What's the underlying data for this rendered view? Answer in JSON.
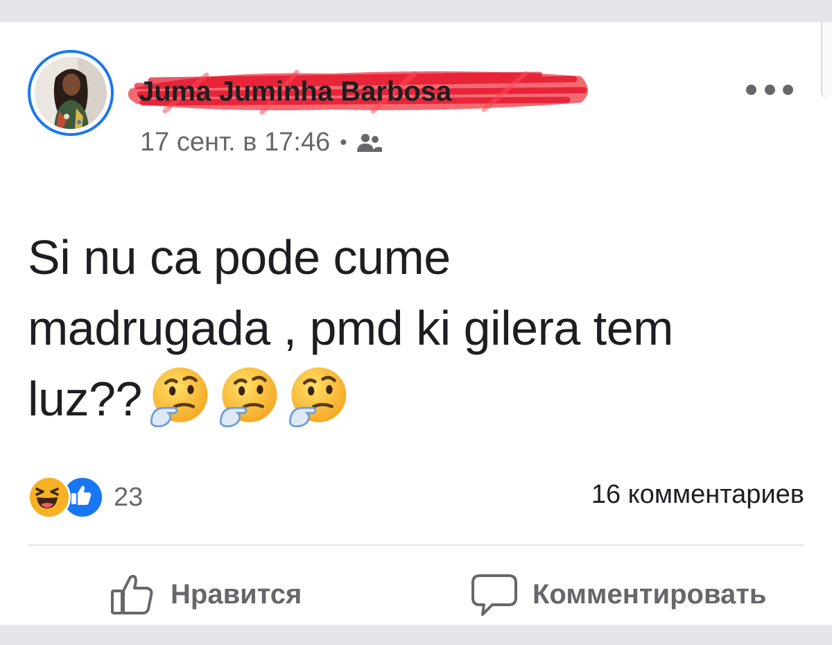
{
  "post": {
    "author_name": "Juma Juminha Barbosa",
    "timestamp": "17 сент. в 17:46",
    "separator": "•",
    "privacy_icon": "friends-icon",
    "text_lines": [
      "Si nu ca pode cume",
      "madrugada  , pmd ki gilera tem",
      "luz??"
    ],
    "emojis": [
      "thinking-face",
      "thinking-face",
      "thinking-face"
    ]
  },
  "reactions": {
    "types": [
      "haha",
      "like"
    ],
    "count": "23"
  },
  "comments_count": "16 комментариев",
  "actions": {
    "like_label": "Нравится",
    "comment_label": "Комментировать"
  },
  "colors": {
    "accent": "#1877f2",
    "redaction": "#f0303c",
    "secondary_text": "#65676b",
    "primary_text": "#1c1e21"
  }
}
